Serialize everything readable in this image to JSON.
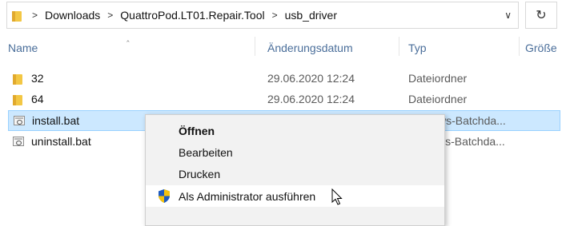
{
  "address_bar": {
    "breadcrumbs": [
      "Downloads",
      "QuattroPod.LT01.Repair.Tool",
      "usb_driver"
    ],
    "separator": ">",
    "dropdown_icon": "chevron-down-icon",
    "refresh_icon": "refresh-icon"
  },
  "columns": {
    "name": "Name",
    "date": "Änderungsdatum",
    "type": "Typ",
    "size": "Größe"
  },
  "files": [
    {
      "name": "32",
      "date": "29.06.2020 12:24",
      "type": "Dateiordner",
      "icon": "folder-icon"
    },
    {
      "name": "64",
      "date": "29.06.2020 12:24",
      "type": "Dateiordner",
      "icon": "folder-icon"
    },
    {
      "name": "install.bat",
      "date": "",
      "type": "ws-Batchda...",
      "icon": "batch-file-icon",
      "selected": true
    },
    {
      "name": "uninstall.bat",
      "date": "",
      "type": "ws-Batchda...",
      "icon": "batch-file-icon"
    }
  ],
  "context_menu": {
    "items": [
      {
        "label": "Öffnen",
        "bold": true
      },
      {
        "label": "Bearbeiten"
      },
      {
        "label": "Drucken"
      },
      {
        "label": "Als Administrator ausführen",
        "icon": "uac-shield-icon",
        "hover": true
      }
    ]
  },
  "colors": {
    "selection_bg": "#cce8ff",
    "header_text": "#4a6e9a",
    "menu_bg": "#f2f2f2"
  }
}
